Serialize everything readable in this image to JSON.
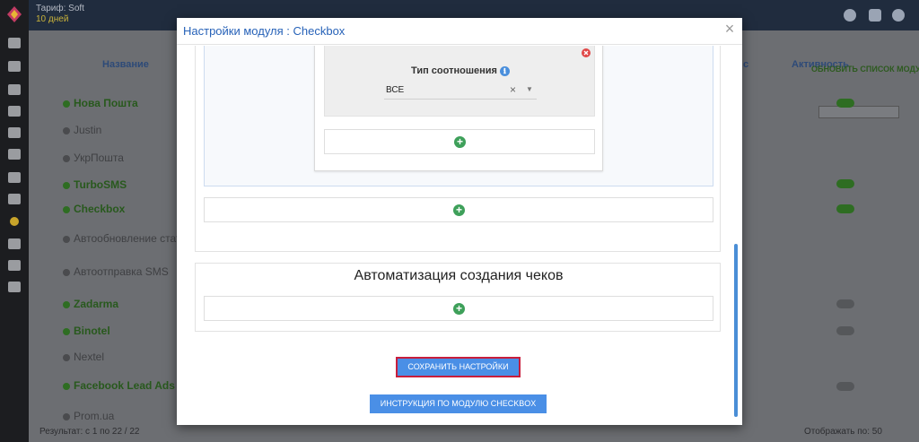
{
  "app": {
    "tariff_label": "Тариф: Soft",
    "tariff_days": "10 дней",
    "columns": {
      "name": "Название",
      "activity": "Активность",
      "status_short": "с"
    },
    "refresh_btn": "ОБНОВИТЬ СПИСОК МОДУЛЕЙ",
    "modules": [
      {
        "name": "Нова Пошта",
        "active": true
      },
      {
        "name": "Justin",
        "active": false
      },
      {
        "name": "УкрПошта",
        "active": false
      },
      {
        "name": "TurboSMS",
        "active": true
      },
      {
        "name": "Checkbox",
        "active": true
      },
      {
        "name": "Автообновление статусов",
        "active": false
      },
      {
        "name": "Автоотправка SMS",
        "active": false
      },
      {
        "name": "Zadarma",
        "active": true
      },
      {
        "name": "Binotel",
        "active": true
      },
      {
        "name": "Nextel",
        "active": false
      },
      {
        "name": "Facebook Lead Ads",
        "active": true
      },
      {
        "name": "Prom.ua",
        "active": false
      }
    ],
    "footer_result": "Результат: с 1 по 22 / 22",
    "footer_per_page": "Отображать по: 50"
  },
  "modal": {
    "title": "Настройки модуля : Checkbox",
    "close_label": "×",
    "condition": {
      "relation_label": "Тип соотношения",
      "info_icon": "ℹ",
      "relation_value": "ВСЕ",
      "clear_label": "×",
      "caret": "▼"
    },
    "automation_title": "Автоматизация создания чеков",
    "add_label": "+",
    "save_button": "СОХРАНИТЬ НАСТРОЙКИ",
    "guide_button": "ИНСТРУКЦИЯ ПО МОДУЛЮ CHECKBOX"
  },
  "colors": {
    "accent": "#4a8fe6",
    "title": "#2762b8",
    "save_border": "#c81e3c",
    "add_icon": "#3ea05a",
    "remove_icon": "#e04848",
    "overlay": "#5e6064"
  },
  "icons": [
    "logo-icon",
    "monitor-icon",
    "grid-icon",
    "calendar-icon",
    "list-icon",
    "inbox-icon",
    "truck-icon",
    "megaphone-icon",
    "chart-icon",
    "coin-icon",
    "info-icon",
    "eye-icon",
    "camera-icon",
    "user-icon",
    "bell-icon",
    "gear-icon",
    "remove-icon",
    "plus-icon",
    "close-icon"
  ]
}
